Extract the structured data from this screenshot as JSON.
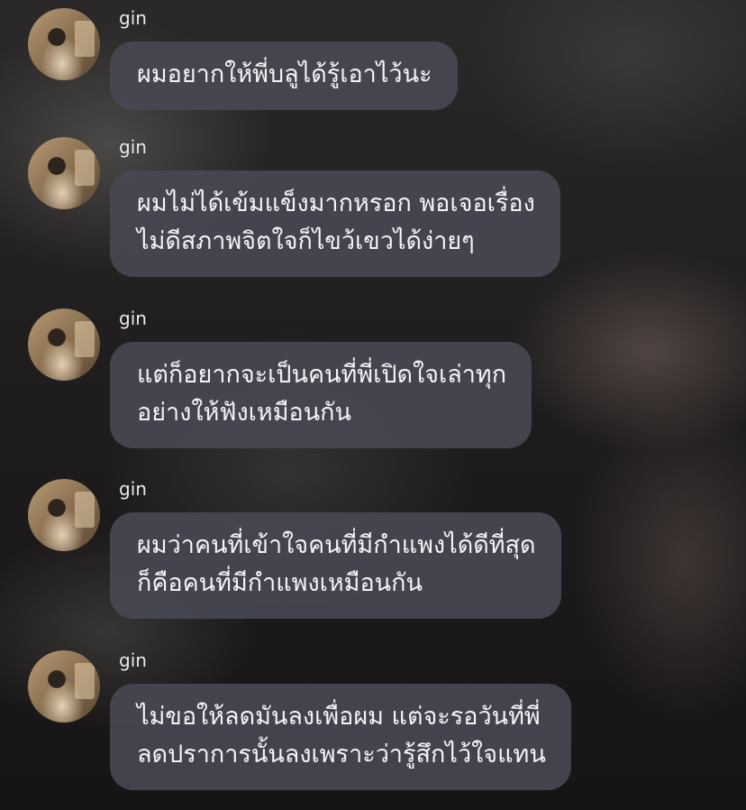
{
  "chat": {
    "messages": [
      {
        "sender": "gin",
        "lines": [
          "ผมอยากให้พี่บลูได้รู้เอาไว้นะ"
        ]
      },
      {
        "sender": "gin",
        "lines": [
          "ผมไม่ได้เข้มแข็งมากหรอก พอเจอเรื่อง",
          "ไม่ดีสภาพจิตใจก็ไขว้เขวได้ง่ายๆ"
        ]
      },
      {
        "sender": "gin",
        "lines": [
          "แต่ก็อยากจะเป็นคนที่พี่เปิดใจเล่าทุก",
          "อย่างให้ฟังเหมือนกัน"
        ]
      },
      {
        "sender": "gin",
        "lines": [
          "ผมว่าคนที่เข้าใจคนที่มีกำแพงได้ดีที่สุด",
          "ก็คือคนที่มีกำแพงเหมือนกัน"
        ]
      },
      {
        "sender": "gin",
        "lines": [
          "ไม่ขอให้ลดมันลงเพื่อผม แต่จะรอวันที่พี่",
          "ลดปราการนั้นลงเพราะว่ารู้สึกไว้ใจแทน"
        ]
      }
    ]
  },
  "colors": {
    "bubble": "#464852",
    "text": "#f4f4f6"
  }
}
